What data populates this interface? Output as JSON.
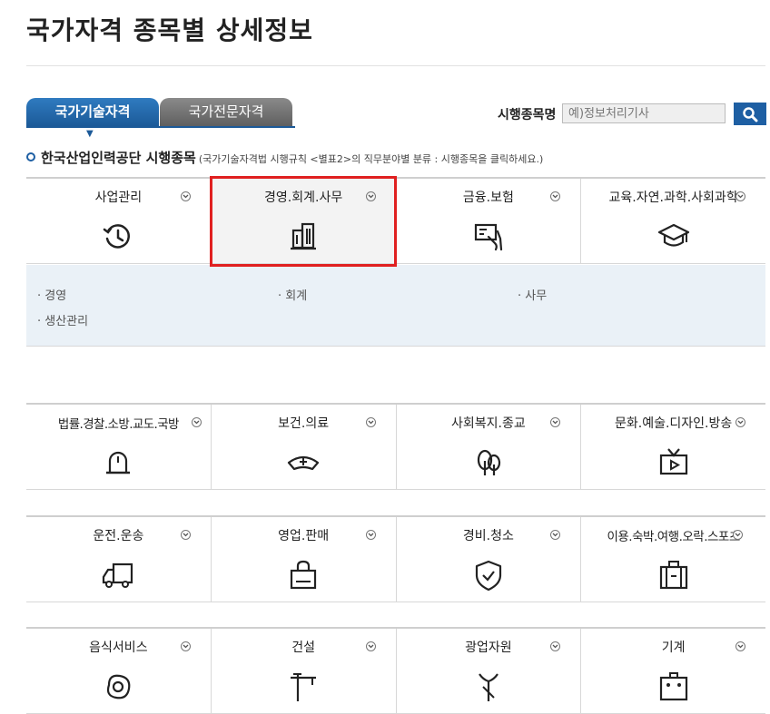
{
  "page_title": "국가자격 종목별 상세정보",
  "tabs": [
    {
      "label": "국가기술자격",
      "active": true
    },
    {
      "label": "국가전문자격",
      "active": false
    }
  ],
  "search": {
    "label": "시행종목명",
    "placeholder": "예)정보처리기사"
  },
  "section": {
    "title": "한국산업인력공단 시행종목",
    "note": "(국가기술자격법 시행규칙 <별표2>의 직무분야별 분류 : 시행종목을 클릭하세요.)"
  },
  "rows": [
    [
      {
        "label": "사업관리",
        "icon": "clock-icon"
      },
      {
        "label": "경영.회계.사무",
        "icon": "building-icon",
        "selected": true
      },
      {
        "label": "금융.보험",
        "icon": "payment-hand-icon"
      },
      {
        "label": "교육.자연.과학.사회과학",
        "icon": "graduation-cap-icon"
      }
    ],
    [
      {
        "label": "법률.경찰.소방.교도.국방",
        "icon": "siren-icon"
      },
      {
        "label": "보건.의료",
        "icon": "nurse-cap-icon"
      },
      {
        "label": "사회복지.종교",
        "icon": "trees-icon"
      },
      {
        "label": "문화.예술.디자인.방송",
        "icon": "tv-icon"
      }
    ],
    [
      {
        "label": "운전.운송",
        "icon": "truck-icon"
      },
      {
        "label": "영업.판매",
        "icon": "shopping-bag-icon"
      },
      {
        "label": "경비.청소",
        "icon": "shield-check-icon"
      },
      {
        "label": "이용.숙박.여행.오락.스포츠",
        "icon": "suitcase-icon"
      }
    ],
    [
      {
        "label": "음식서비스",
        "icon": "fried-egg-icon"
      },
      {
        "label": "건설",
        "icon": "crane-icon"
      },
      {
        "label": "광업자원",
        "icon": "pickaxe-icon"
      },
      {
        "label": "기계",
        "icon": "machine-icon"
      }
    ]
  ],
  "details": [
    "· 경영",
    "· 회계",
    "· 사무",
    "· 생산관리"
  ]
}
